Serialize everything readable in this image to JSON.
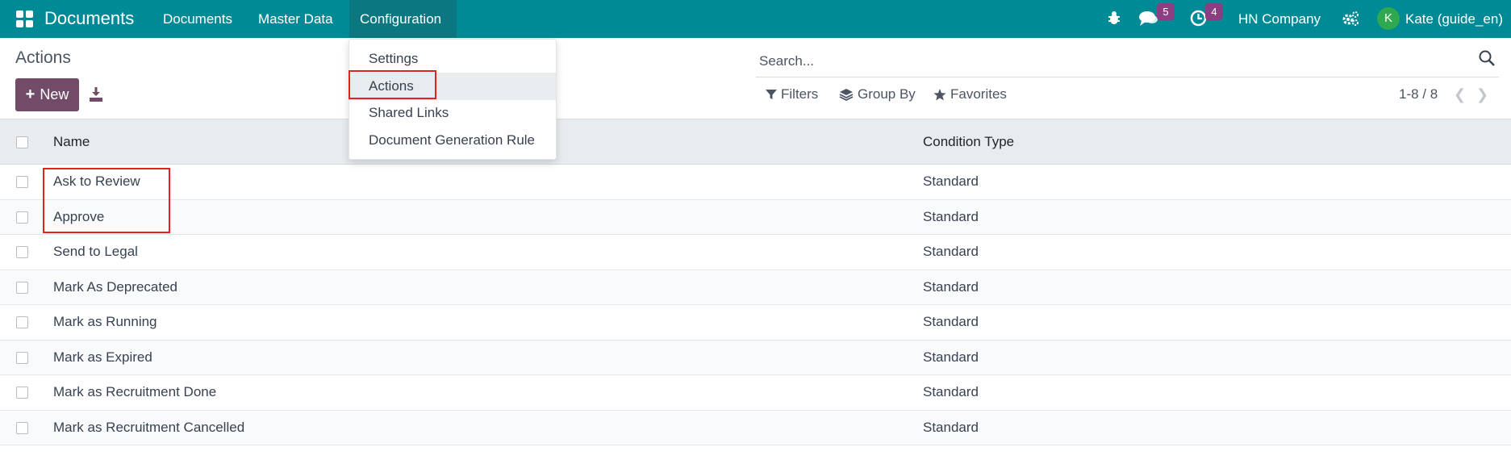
{
  "navbar": {
    "app_title": "Documents",
    "menu": [
      "Documents",
      "Master Data",
      "Configuration"
    ],
    "messages_count": "5",
    "activities_count": "4",
    "company": "HN Company",
    "user_initial": "K",
    "user_name": "Kate (guide_en)"
  },
  "control_panel": {
    "breadcrumb": "Actions",
    "new_label": "New",
    "search_placeholder": "Search...",
    "filters_label": "Filters",
    "groupby_label": "Group By",
    "favorites_label": "Favorites",
    "pager": "1-8 / 8"
  },
  "dropdown": {
    "items": [
      "Settings",
      "Actions",
      "Shared Links",
      "Document Generation Rule"
    ],
    "active": "Actions"
  },
  "table": {
    "columns": [
      "Name",
      "Condition Type"
    ],
    "rows": [
      {
        "name": "Ask to Review",
        "condition": "Standard"
      },
      {
        "name": "Approve",
        "condition": "Standard"
      },
      {
        "name": "Send to Legal",
        "condition": "Standard"
      },
      {
        "name": "Mark As Deprecated",
        "condition": "Standard"
      },
      {
        "name": "Mark as Running",
        "condition": "Standard"
      },
      {
        "name": "Mark as Expired",
        "condition": "Standard"
      },
      {
        "name": "Mark as Recruitment Done",
        "condition": "Standard"
      },
      {
        "name": "Mark as Recruitment Cancelled",
        "condition": "Standard"
      }
    ]
  },
  "colors": {
    "navbar": "#008a96",
    "primary": "#714b67",
    "badge": "#8a3f83",
    "highlight": "#e0231f"
  }
}
